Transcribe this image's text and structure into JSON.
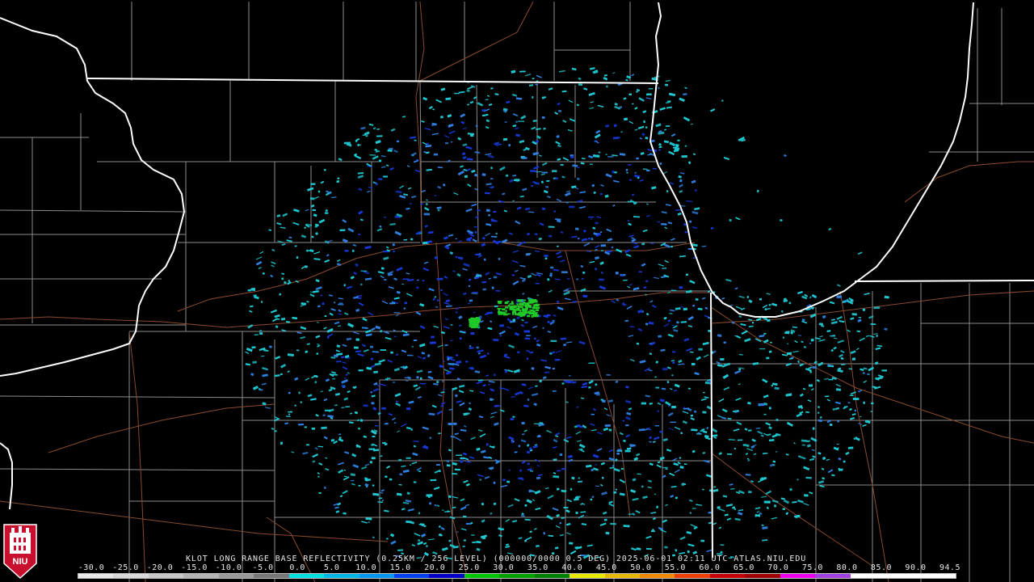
{
  "product": {
    "caption": "KLOT LONG RANGE BASE REFLECTIVITY (0.25KM / 256 LEVEL) (000000/0000 0.5 DEG) 2025-06-01 02:11 UTC  ATLAS.NIU.EDU",
    "radar_site": "KLOT",
    "product_name": "LONG RANGE BASE REFLECTIVITY",
    "resolution": "0.25KM / 256 LEVEL",
    "elevation": "0.5 DEG",
    "datetime": "2025-06-01 02:11 UTC",
    "source": "ATLAS.NIU.EDU"
  },
  "logo": {
    "text": "NIU",
    "icon": "niu-huskie-logo-icon"
  },
  "scale": {
    "labels": [
      "-30.0",
      "-25.0",
      "-20.0",
      "-15.0",
      "-10.0",
      "-5.0",
      "0.0",
      "5.0",
      "10.0",
      "15.0",
      "20.0",
      "25.0",
      "30.0",
      "35.0",
      "40.0",
      "45.0",
      "50.0",
      "55.0",
      "60.0",
      "65.0",
      "70.0",
      "75.0",
      "80.0",
      "85.0",
      "90.0",
      "94.5"
    ],
    "colors": [
      "#e8e8e8",
      "#d8d8d8",
      "#c8c8c8",
      "#b4b4b4",
      "#9a9a9a",
      "#787878",
      "#00e0e0",
      "#00b8e8",
      "#0096f0",
      "#0040f0",
      "#0000c8",
      "#00c800",
      "#00a000",
      "#008000",
      "#e8e800",
      "#e8b800",
      "#f08800",
      "#f04000",
      "#c80000",
      "#a00000",
      "#f000f0",
      "#a040e0",
      "#ffffff",
      "#ffffff",
      "#ffffff"
    ]
  },
  "colors": {
    "background": "#000000",
    "state_border": "#ffffff",
    "county_border": "#8c8c8c",
    "highway": "#8a4a2e",
    "echo_light": "#1ec8d2",
    "echo_medium": "#2e7fe0",
    "echo_strong": "#1638d2",
    "echo_green": "#20c828"
  }
}
